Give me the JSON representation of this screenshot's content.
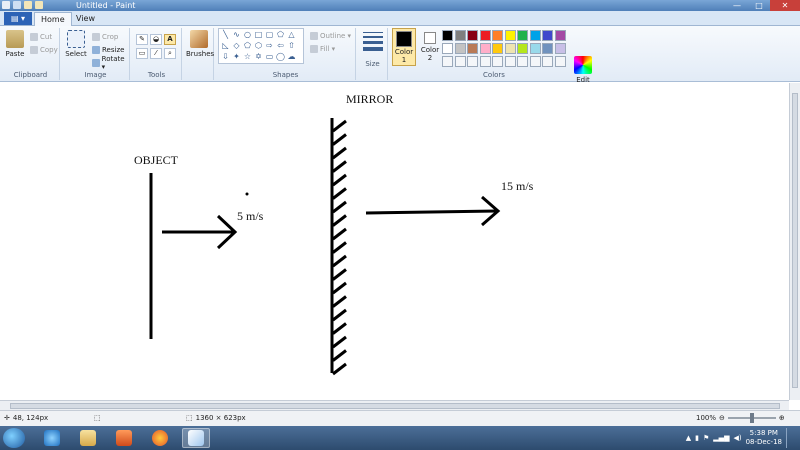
{
  "window": {
    "title": "Untitled - Paint",
    "minimize": "—",
    "maximize": "□",
    "close": "✕"
  },
  "tabs": {
    "file": "▤ ▾",
    "home": "Home",
    "view": "View"
  },
  "ribbon": {
    "clipboard": {
      "label": "Clipboard",
      "paste": "Paste",
      "cut": "Cut",
      "copy": "Copy"
    },
    "image": {
      "label": "Image",
      "select": "Select",
      "crop": "Crop",
      "resize": "Resize",
      "rotate": "Rotate ▾"
    },
    "tools": {
      "label": "Tools",
      "brushes": "Brushes"
    },
    "shapes": {
      "label": "Shapes",
      "outline": "Outline ▾",
      "fill": "Fill ▾"
    },
    "size": {
      "label": "Size"
    },
    "colors": {
      "label": "Colors",
      "color1": "Color 1",
      "color2": "Color 2",
      "edit": "Edit colors",
      "color1_value": "#000000",
      "color2_value": "#ffffff",
      "palette_row1": [
        "#000000",
        "#7f7f7f",
        "#880015",
        "#ed1c24",
        "#ff7f27",
        "#fff200",
        "#22b14c",
        "#00a2e8",
        "#3f48cc",
        "#a349a4"
      ],
      "palette_row2": [
        "#ffffff",
        "#c3c3c3",
        "#b97a57",
        "#ffaec9",
        "#ffc90e",
        "#efe4b0",
        "#b5e61d",
        "#99d9ea",
        "#7092be",
        "#c8bfe7"
      ]
    }
  },
  "canvas": {
    "object_label": "OBJECT",
    "mirror_label": "MIRROR",
    "speed_object": "5 m/s",
    "speed_image": "15 m/s"
  },
  "status": {
    "cursor_pos": "48, 124px",
    "image_size": "1360 × 623px",
    "zoom": "100%"
  },
  "taskbar": {
    "time": "5:38 PM",
    "date": "08-Dec-18"
  }
}
